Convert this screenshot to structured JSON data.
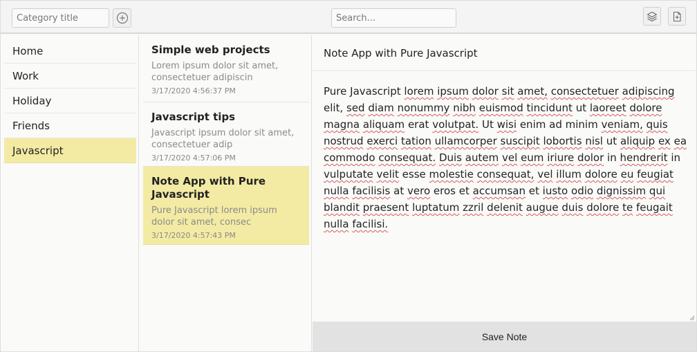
{
  "toolbar": {
    "category_placeholder": "Category title",
    "search_placeholder": "Search..."
  },
  "categories": [
    {
      "label": "Home",
      "active": false
    },
    {
      "label": "Work",
      "active": false
    },
    {
      "label": "Holiday",
      "active": false
    },
    {
      "label": "Friends",
      "active": false
    },
    {
      "label": "Javascript",
      "active": true
    }
  ],
  "notes": [
    {
      "title": "Simple web projects",
      "excerpt": "Lorem ipsum dolor sit amet, consectetuer adipiscin",
      "date": "3/17/2020 4:56:37 PM",
      "active": false
    },
    {
      "title": "Javascript tips",
      "excerpt": "Javascript ipsum dolor sit amet, consectetuer adip",
      "date": "3/17/2020 4:57:06 PM",
      "active": false
    },
    {
      "title": "Note App with Pure Javascript",
      "excerpt": "Pure Javascript lorem ipsum dolor sit amet, consec",
      "date": "3/17/2020 4:57:43 PM",
      "active": true
    }
  ],
  "editor": {
    "title": "Note App with Pure Javascript",
    "body": "Pure Javascript lorem ipsum dolor sit amet, consectetuer adipiscing elit, sed diam nonummy nibh euismod tincidunt ut laoreet dolore magna aliquam erat volutpat. Ut wisi enim ad minim veniam, quis nostrud exerci tation ullamcorper suscipit lobortis nisl ut aliquip ex ea commodo consequat. Duis autem vel eum iriure dolor in hendrerit in vulputate velit esse molestie consequat, vel illum dolore eu feugiat nulla facilisis at vero eros et accumsan et iusto odio dignissim qui blandit praesent luptatum zzril delenit augue duis dolore te feugait nulla facilisi.",
    "save_label": "Save Note"
  },
  "colors": {
    "active_highlight": "#f3eba4",
    "save_button_bg": "#e2e2e2",
    "spellcheck_underline": "#d65a5a"
  },
  "icons": {
    "add_category": "plus-circle-icon",
    "layers": "layers-icon",
    "new_note": "file-plus-icon"
  }
}
